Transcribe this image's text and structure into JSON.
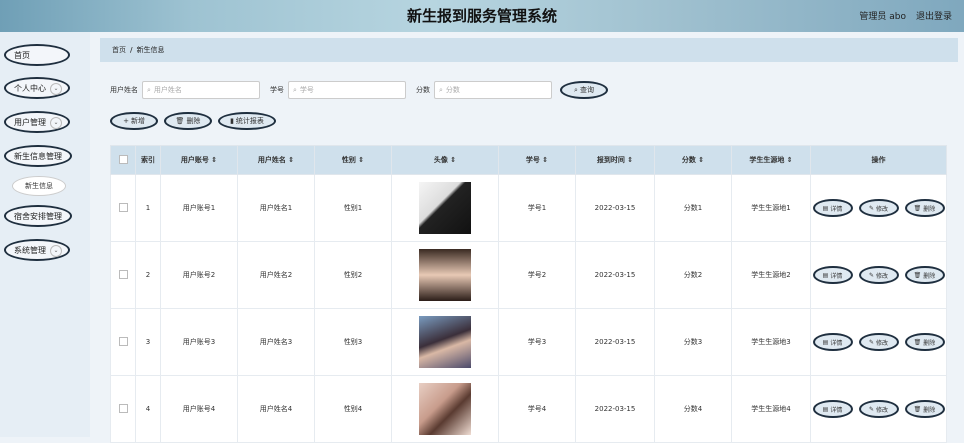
{
  "header": {
    "title": "新生报到服务管理系统",
    "user": "管理员 abo",
    "logout": "退出登录"
  },
  "sidebar": {
    "items": [
      {
        "label": "首页"
      },
      {
        "label": "个人中心"
      },
      {
        "label": "用户管理"
      },
      {
        "label": "新生信息管理"
      },
      {
        "label": "新生信息"
      },
      {
        "label": "宿舍安排管理"
      },
      {
        "label": "系统管理"
      }
    ]
  },
  "breadcrumb": {
    "home": "首页",
    "sep": "/",
    "current": "新生信息"
  },
  "search": {
    "fields": [
      {
        "label": "用户姓名",
        "placeholder": "用户姓名"
      },
      {
        "label": "学号",
        "placeholder": "学号"
      },
      {
        "label": "分数",
        "placeholder": "分数"
      }
    ],
    "query_label": "查询"
  },
  "actions": {
    "add": "新增",
    "delete": "删除",
    "report": "统计报表"
  },
  "table": {
    "columns": [
      "索引",
      "用户账号",
      "用户姓名",
      "性别",
      "头像",
      "学号",
      "报到时间",
      "分数",
      "学生生源地",
      "操作"
    ],
    "rows": [
      {
        "index": "1",
        "account": "用户账号1",
        "name": "用户姓名1",
        "gender": "性别1",
        "sid": "学号1",
        "time": "2022-03-15",
        "score": "分数1",
        "origin": "学生生源地1"
      },
      {
        "index": "2",
        "account": "用户账号2",
        "name": "用户姓名2",
        "gender": "性别2",
        "sid": "学号2",
        "time": "2022-03-15",
        "score": "分数2",
        "origin": "学生生源地2"
      },
      {
        "index": "3",
        "account": "用户账号3",
        "name": "用户姓名3",
        "gender": "性别3",
        "sid": "学号3",
        "time": "2022-03-15",
        "score": "分数3",
        "origin": "学生生源地3"
      },
      {
        "index": "4",
        "account": "用户账号4",
        "name": "用户姓名4",
        "gender": "性别4",
        "sid": "学号4",
        "time": "2022-03-15",
        "score": "分数4",
        "origin": "学生生源地4"
      }
    ],
    "op_labels": {
      "detail": "详情",
      "edit": "修改",
      "delete": "删除"
    }
  }
}
